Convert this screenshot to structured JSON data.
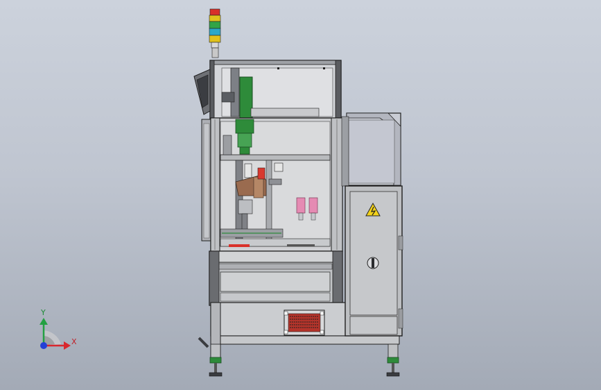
{
  "viewport": {
    "background_top": "#ccd2dc",
    "background_bottom": "#a3aab6"
  },
  "colors": {
    "frame_outline": "#2a2a2a",
    "frame_panel": "#c9c9c9",
    "panel_glass": "#d6d8dc",
    "cabinet": "#b9bcc0",
    "motor_green": "#2e8b3a",
    "light_red": "#d8312a",
    "light_yellow": "#e0c21c",
    "light_green": "#32a447",
    "light_blue": "#2aa8c8",
    "warning_yellow": "#f2d21a",
    "vent_red": "#b3342b",
    "sensor_pink": "#e58bb3",
    "axis_x": "#d8272d",
    "axis_y": "#23a042",
    "axis_z": "#2440d6"
  },
  "icons": {
    "warning": "high-voltage-warning-icon",
    "handle": "cabinet-lock-icon",
    "triad": "coordinate-triad-icon"
  },
  "triad": {
    "x_label": "X",
    "y_label": "Y"
  }
}
